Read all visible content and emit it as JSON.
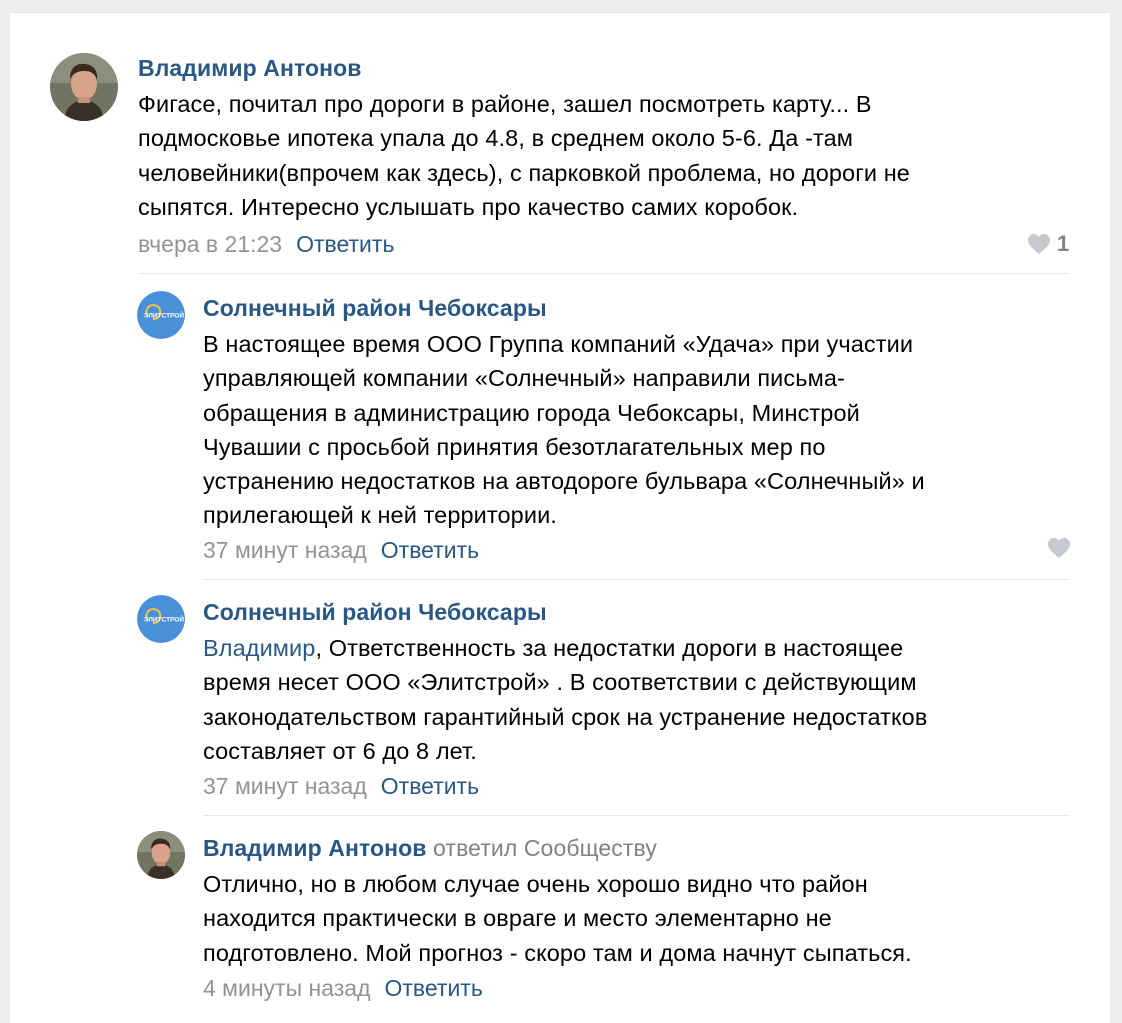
{
  "comments": [
    {
      "author": "Владимир Антонов",
      "lines": [
        "Фигасе, почитал про дороги в районе, зашел посмотреть карту... В",
        "подмосковье ипотека упала до 4.8, в среднем около 5-6. Да -там",
        "человейники(впрочем как здесь), с парковкой проблема, но дороги не",
        "сыпятся. Интересно услышать про качество самих коробок."
      ],
      "time": "вчера в 21:23",
      "reply": "Ответить",
      "likes": "1",
      "avatar_icon": "user-photo"
    },
    {
      "author": "Солнечный район Чебоксары",
      "lines": [
        "В настоящее время ООО Группа компаний «Удача» при участии",
        "управляющей компании «Солнечный» направили письма-",
        "обращения в администрацию города Чебоксары, Минстрой",
        "Чувашии с просьбой принятия безотлагательных мер по",
        "устранению недостатков на автодороге бульвара «Солнечный» и",
        "прилегающей к ней территории."
      ],
      "time": "37 минут назад",
      "reply": "Ответить",
      "avatar_icon": "community-logo",
      "logo_text": "ЭЛИТСТРОЙ"
    },
    {
      "author": "Солнечный район Чебоксары",
      "mention": "Владимир",
      "first_line_rest": ", Ответственность за недостатки дороги в настоящее",
      "lines": [
        "время несет ООО «Элитстрой» . В соответствии с действующим",
        "законодательством гарантийный срок на устранение недостатков",
        "составляет от 6 до 8 лет."
      ],
      "time": "37 минут назад",
      "reply": "Ответить",
      "avatar_icon": "community-logo",
      "logo_text": "ЭЛИТСТРОЙ"
    },
    {
      "author": "Владимир Антонов",
      "replied_to": "ответил Сообществу",
      "lines": [
        "Отлично, но в любом случае очень хорошо видно что район",
        "находится практически в овраге и место элементарно не",
        "подготовлено. Мой прогноз - скоро там и дома начнут сыпаться."
      ],
      "time": "4 минуты назад",
      "reply": "Ответить",
      "avatar_icon": "user-photo"
    }
  ],
  "colors": {
    "link": "#2a5885",
    "meta": "#939393",
    "logo_bg": "#4a90d9"
  }
}
